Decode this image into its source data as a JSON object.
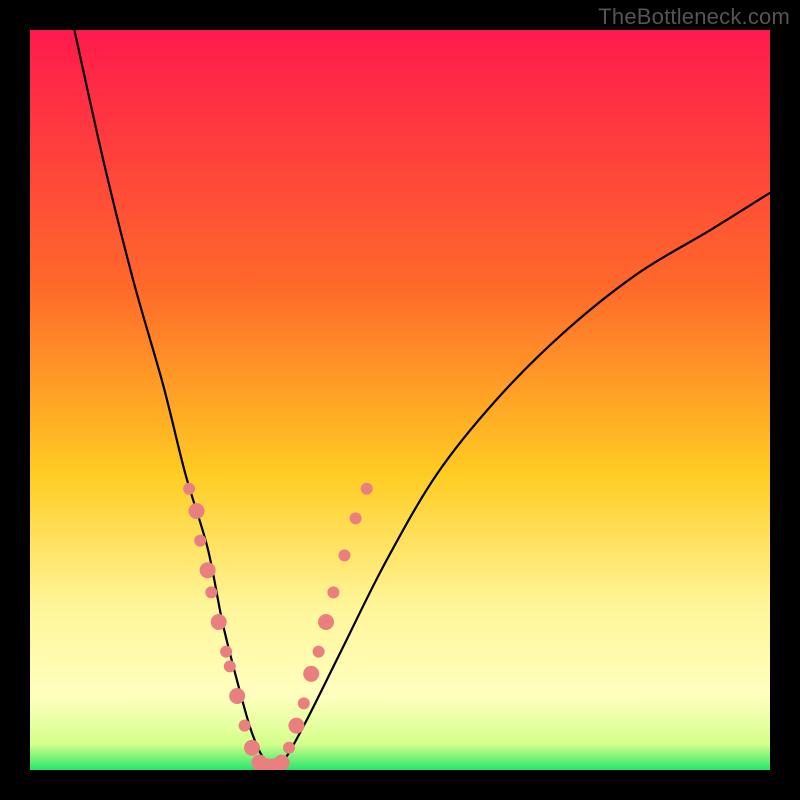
{
  "watermark": "TheBottleneck.com",
  "chart_data": {
    "type": "line",
    "title": "",
    "xlabel": "",
    "ylabel": "",
    "xlim": [
      0,
      100
    ],
    "ylim": [
      0,
      100
    ],
    "background_gradient": {
      "stops": [
        {
          "offset": 0,
          "color": "#ff1a4d"
        },
        {
          "offset": 0.35,
          "color": "#ff6a2a"
        },
        {
          "offset": 0.6,
          "color": "#ffcc22"
        },
        {
          "offset": 0.78,
          "color": "#fff69a"
        },
        {
          "offset": 0.9,
          "color": "#ffffbe"
        },
        {
          "offset": 0.965,
          "color": "#d4ff8a"
        },
        {
          "offset": 1.0,
          "color": "#28e66b"
        }
      ]
    },
    "series": [
      {
        "name": "bottleneck-curve",
        "x": [
          6,
          10,
          14,
          18,
          21,
          24,
          26,
          28,
          30,
          32,
          34,
          37,
          42,
          48,
          55,
          63,
          72,
          82,
          92,
          100
        ],
        "y": [
          100,
          82,
          66,
          52,
          40,
          30,
          20,
          12,
          5,
          1,
          1,
          6,
          16,
          28,
          40,
          50,
          59,
          67,
          73,
          78
        ]
      }
    ],
    "scatter_points": {
      "name": "sample-markers",
      "color": "#e9807f",
      "radius_small": 6,
      "radius_large": 8,
      "points": [
        {
          "x": 21.5,
          "y": 38,
          "r": "small"
        },
        {
          "x": 22.5,
          "y": 35,
          "r": "large"
        },
        {
          "x": 23.0,
          "y": 31,
          "r": "small"
        },
        {
          "x": 24.0,
          "y": 27,
          "r": "large"
        },
        {
          "x": 24.5,
          "y": 24,
          "r": "small"
        },
        {
          "x": 25.5,
          "y": 20,
          "r": "large"
        },
        {
          "x": 26.5,
          "y": 16,
          "r": "small"
        },
        {
          "x": 27.0,
          "y": 14,
          "r": "small"
        },
        {
          "x": 28.0,
          "y": 10,
          "r": "large"
        },
        {
          "x": 29.0,
          "y": 6,
          "r": "small"
        },
        {
          "x": 30.0,
          "y": 3,
          "r": "large"
        },
        {
          "x": 31.0,
          "y": 1,
          "r": "large"
        },
        {
          "x": 32.0,
          "y": 0.5,
          "r": "large"
        },
        {
          "x": 33.0,
          "y": 0.5,
          "r": "large"
        },
        {
          "x": 34.0,
          "y": 1,
          "r": "large"
        },
        {
          "x": 35.0,
          "y": 3,
          "r": "small"
        },
        {
          "x": 36.0,
          "y": 6,
          "r": "large"
        },
        {
          "x": 37.0,
          "y": 9,
          "r": "small"
        },
        {
          "x": 38.0,
          "y": 13,
          "r": "large"
        },
        {
          "x": 39.0,
          "y": 16,
          "r": "small"
        },
        {
          "x": 40.0,
          "y": 20,
          "r": "large"
        },
        {
          "x": 41.0,
          "y": 24,
          "r": "small"
        },
        {
          "x": 42.5,
          "y": 29,
          "r": "small"
        },
        {
          "x": 44.0,
          "y": 34,
          "r": "small"
        },
        {
          "x": 45.5,
          "y": 38,
          "r": "small"
        }
      ]
    }
  }
}
